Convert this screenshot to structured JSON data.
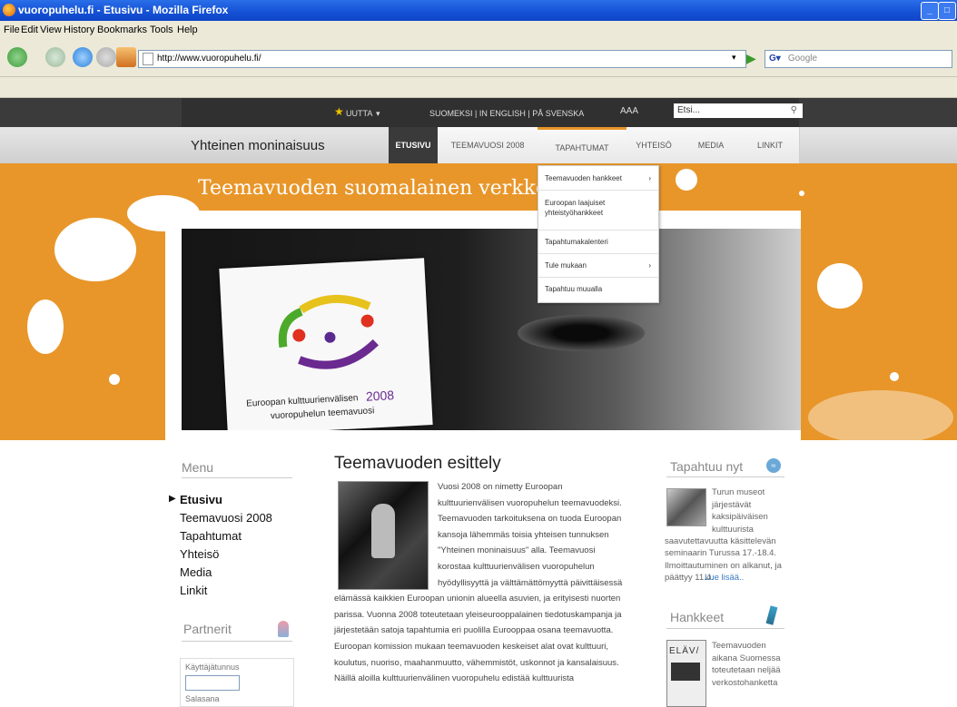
{
  "window": {
    "title": "vuoropuhelu.fi - Etusivu - Mozilla Firefox"
  },
  "menubar": [
    "File",
    "Edit",
    "View",
    "History",
    "Bookmarks",
    "Tools",
    "Help"
  ],
  "address": {
    "url": "http://www.vuoropuhelu.fi/"
  },
  "search": {
    "placeholder": "Google"
  },
  "site": {
    "top": {
      "uutta": "UUTTA",
      "languages": "SUOMEKSI | IN ENGLISH | PÅ SVENSKA",
      "textsize": "AAA",
      "search": "Etsi..."
    },
    "logo": "Yhteinen moninaisuus",
    "nav": [
      "ETUSIVU",
      "TEEMAVUOSI 2008",
      "TAPAHTUMAT",
      "YHTEISÖ",
      "MEDIA",
      "LINKIT"
    ],
    "dropdown": [
      "Teemavuoden hankkeet",
      "Euroopan laajuiset yhteistyöhankkeet",
      "Tapahtumakalenteri",
      "Tule mukaan",
      "Tapahtuu muualla"
    ],
    "hero_title": "Teemavuoden suomalainen verkkopalvelu",
    "poster": {
      "line1": "Euroopan kulttuurienvälisen",
      "year": "2008",
      "line2": "vuoropuhelun teemavuosi"
    },
    "menu": {
      "title": "Menu",
      "items": [
        "Etusivu",
        "Teemavuosi 2008",
        "Tapahtumat",
        "Yhteisö",
        "Media",
        "Linkit"
      ]
    },
    "partners": {
      "title": "Partnerit",
      "user_label": "Käyttäjätunnus",
      "pass_label": "Salasana"
    },
    "article": {
      "title": "Teemavuoden esittely",
      "lines": [
        "Vuosi 2008 on nimetty Euroopan",
        "kulttuurienvälisen vuoropuhelun teemavuodeksi.",
        "Teemavuoden tarkoituksena on tuoda Euroopan",
        "kansoja lähemmäs toisia yhteisen tunnuksen",
        "\"Yhteinen moninaisuus\" alla. Teemavuosi",
        "korostaa kulttuurienvälisen vuoropuhelun",
        "hyödyllisyyttä ja välttämättömyyttä päivittäisessä",
        "elämässä kaikkien Euroopan unionin alueella asuvien, ja erityisesti nuorten",
        "parissa. Vuonna 2008 toteutetaan yleiseurooppalainen tiedotuskampanja ja",
        "järjestetään satoja tapahtumia eri puolilla Eurooppaa osana teemavuotta.",
        "Euroopan komission mukaan teemavuoden keskeiset alat ovat kulttuuri,",
        "koulutus, nuoriso, maahanmuutto, vähemmistöt, uskonnot ja kansalaisuus.",
        "Näillä aloilla kulttuurienvälinen vuoropuhelu edistää kulttuurista"
      ]
    },
    "news": {
      "title": "Tapahtuu nyt",
      "lines": [
        "Turun museot",
        "järjestävät",
        "kaksipäiväisen",
        "kulttuurista",
        "saavutettavuutta käsittelevän",
        "seminaarin Turussa 17.-18.4.",
        "Ilmoittautuminen on alkanut, ja",
        "päättyy 11.4."
      ],
      "more": "Lue lisää.."
    },
    "projects": {
      "title": "Hankkeet",
      "lines": [
        "Teemavuoden",
        "aikana Suomessa",
        "toteutetaan neljää",
        "verkostohanketta"
      ],
      "thumb": "ELÄV/"
    }
  }
}
